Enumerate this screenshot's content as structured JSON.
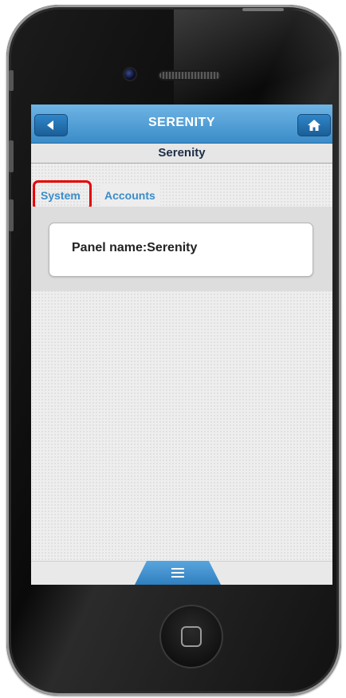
{
  "header": {
    "title": "SERENITY"
  },
  "subheader": {
    "title": "Serenity"
  },
  "tabs": [
    {
      "label": "System",
      "selected": true
    },
    {
      "label": "Accounts",
      "selected": false
    }
  ],
  "panel": {
    "text": "Panel name:Serenity"
  },
  "icons": {
    "back": "back-arrow-icon",
    "home": "home-icon",
    "menu": "menu-icon"
  },
  "colors": {
    "accent": "#3a8cc8",
    "highlight": "#e60000"
  }
}
